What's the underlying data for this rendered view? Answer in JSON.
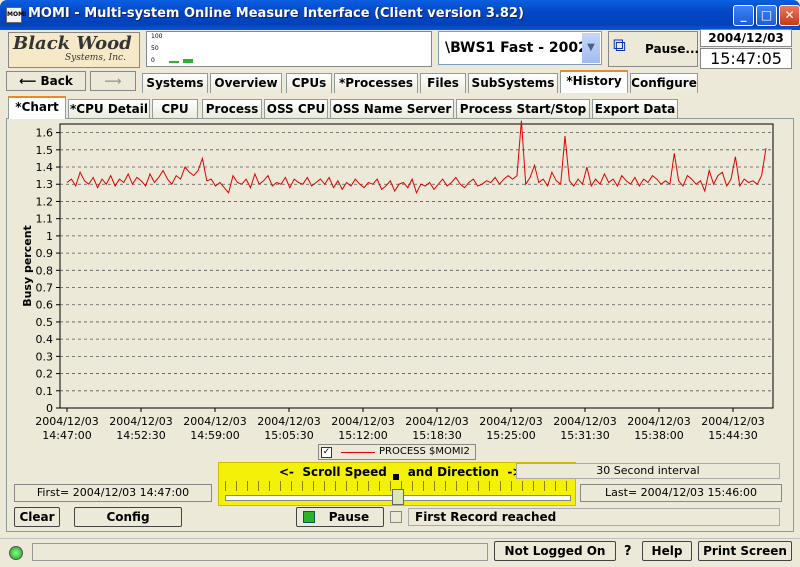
{
  "window": {
    "title": "MOMI - Multi-system Online Measure Interface (Client version 3.82)",
    "icon_text": "MOMI",
    "controls": [
      "minimize-icon",
      "maximize-icon",
      "close-icon"
    ]
  },
  "header": {
    "logo_text": "Black Wood",
    "logo_sub": "Systems, Inc.",
    "mini_graph_labels": [
      "100",
      "50",
      "0"
    ],
    "mini_graph_levels": [
      0.08,
      0.12
    ],
    "system": "\\BWS1 Fast - 2002",
    "pause_label": "Pause...",
    "date": "2004/12/03",
    "time": "15:47:05"
  },
  "nav": {
    "back_label": "Back",
    "forward_label": "",
    "main_tabs": [
      "Systems",
      "Overview",
      "CPUs",
      "*Processes",
      "Files",
      "SubSystems",
      "*History",
      "Configure"
    ],
    "main_active": "*History",
    "sub_tabs": [
      "*Chart",
      "*CPU Detail",
      "CPU",
      "Process",
      "OSS CPU",
      "OSS Name Server",
      "Process Start/Stop",
      "Export Data"
    ],
    "sub_active": "*Chart"
  },
  "chart_data": {
    "type": "line",
    "ylabel": "Busy percent",
    "ylim": [
      0,
      1.65
    ],
    "yticks": [
      0,
      0.1,
      0.2,
      0.3,
      0.4,
      0.5,
      0.6,
      0.7,
      0.8,
      0.9,
      1,
      1.1,
      1.2,
      1.3,
      1.4,
      1.5,
      1.6
    ],
    "xtick_labels": [
      [
        "2004/12/03",
        "14:47:00"
      ],
      [
        "2004/12/03",
        "14:52:30"
      ],
      [
        "2004/12/03",
        "14:59:00"
      ],
      [
        "2004/12/03",
        "15:05:30"
      ],
      [
        "2004/12/03",
        "15:12:00"
      ],
      [
        "2004/12/03",
        "15:18:30"
      ],
      [
        "2004/12/03",
        "15:25:00"
      ],
      [
        "2004/12/03",
        "15:31:30"
      ],
      [
        "2004/12/03",
        "15:38:00"
      ],
      [
        "2004/12/03",
        "15:44:30"
      ]
    ],
    "grid": true,
    "series": [
      {
        "name": "PROCESS $MOMI2",
        "color": "#e00000",
        "values": [
          1.31,
          1.33,
          1.29,
          1.37,
          1.32,
          1.3,
          1.34,
          1.28,
          1.33,
          1.3,
          1.35,
          1.29,
          1.33,
          1.31,
          1.36,
          1.3,
          1.34,
          1.32,
          1.29,
          1.36,
          1.31,
          1.34,
          1.38,
          1.33,
          1.3,
          1.35,
          1.33,
          1.4,
          1.37,
          1.35,
          1.38,
          1.45,
          1.32,
          1.33,
          1.29,
          1.31,
          1.28,
          1.25,
          1.35,
          1.31,
          1.3,
          1.33,
          1.28,
          1.36,
          1.3,
          1.32,
          1.35,
          1.29,
          1.31,
          1.3,
          1.34,
          1.28,
          1.33,
          1.31,
          1.3,
          1.34,
          1.29,
          1.31,
          1.33,
          1.3,
          1.34,
          1.28,
          1.32,
          1.27,
          1.31,
          1.29,
          1.33,
          1.3,
          1.28,
          1.31,
          1.3,
          1.33,
          1.27,
          1.29,
          1.32,
          1.26,
          1.3,
          1.31,
          1.28,
          1.33,
          1.25,
          1.3,
          1.29,
          1.31,
          1.27,
          1.3,
          1.33,
          1.29,
          1.31,
          1.34,
          1.3,
          1.28,
          1.31,
          1.33,
          1.29,
          1.3,
          1.32,
          1.31,
          1.34,
          1.3,
          1.33,
          1.35,
          1.33,
          1.35,
          1.67,
          1.3,
          1.34,
          1.41,
          1.31,
          1.33,
          1.29,
          1.37,
          1.32,
          1.3,
          1.58,
          1.32,
          1.29,
          1.33,
          1.3,
          1.4,
          1.29,
          1.33,
          1.3,
          1.36,
          1.31,
          1.33,
          1.29,
          1.35,
          1.32,
          1.3,
          1.34,
          1.29,
          1.33,
          1.31,
          1.35,
          1.33,
          1.3,
          1.32,
          1.3,
          1.48,
          1.32,
          1.29,
          1.35,
          1.33,
          1.3,
          1.32,
          1.26,
          1.38,
          1.3,
          1.35,
          1.37,
          1.29,
          1.33,
          1.46,
          1.29,
          1.33,
          1.31,
          1.32,
          1.3,
          1.35,
          1.51
        ]
      }
    ]
  },
  "legend": {
    "checked_mark": "✓",
    "label": "PROCESS $MOMI2"
  },
  "controls": {
    "scroll_label": "<-  Scroll Speed     and Direction  ->",
    "interval": "30 Second interval",
    "scroll_position": 0.5,
    "first": "First= 2004/12/03 14:47:00",
    "last": "Last= 2004/12/03 15:46:00",
    "clear_label": "Clear",
    "config_label": "Config",
    "pause_label": "Pause",
    "first_record": "First Record reached"
  },
  "statusbar": {
    "status_text": "",
    "not_logged_on_label": "Not Logged On",
    "help_question": "?",
    "help_label": "Help",
    "print_label": "Print Screen"
  }
}
